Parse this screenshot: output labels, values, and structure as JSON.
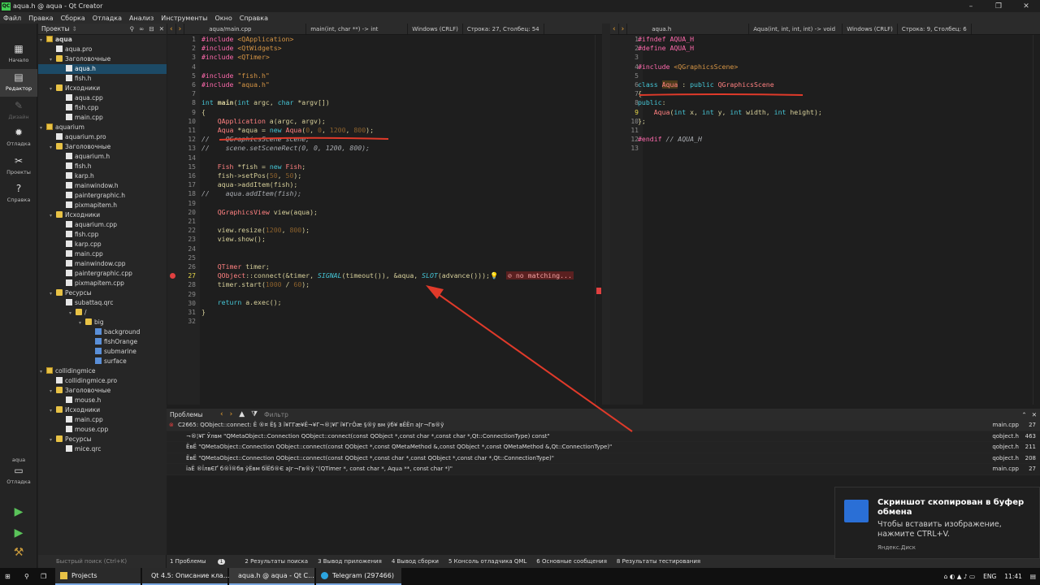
{
  "window": {
    "title": "aqua.h @ aqua - Qt Creator"
  },
  "menu": [
    "Файл",
    "Правка",
    "Сборка",
    "Отладка",
    "Анализ",
    "Инструменты",
    "Окно",
    "Справка"
  ],
  "modes": [
    {
      "label": "Начало",
      "icon": "▦"
    },
    {
      "label": "Редактор",
      "icon": "▤"
    },
    {
      "label": "Дизайн",
      "icon": "✎"
    },
    {
      "label": "Отладка",
      "icon": "✹"
    },
    {
      "label": "Проекты",
      "icon": "✂"
    },
    {
      "label": "Справка",
      "icon": "?"
    }
  ],
  "kit": {
    "name": "aqua",
    "label": "Отладка"
  },
  "projects": {
    "title": "Проекты",
    "rows": [
      {
        "t": "aqua",
        "lvl": 0,
        "icon": "proj",
        "bold": true
      },
      {
        "t": "aqua.pro",
        "lvl": 1,
        "icon": "file"
      },
      {
        "t": "Заголовочные",
        "lvl": 1,
        "icon": "folder"
      },
      {
        "t": "aqua.h",
        "lvl": 2,
        "icon": "file",
        "sel": true
      },
      {
        "t": "fish.h",
        "lvl": 2,
        "icon": "file"
      },
      {
        "t": "Исходники",
        "lvl": 1,
        "icon": "folder"
      },
      {
        "t": "aqua.cpp",
        "lvl": 2,
        "icon": "file"
      },
      {
        "t": "fish.cpp",
        "lvl": 2,
        "icon": "file"
      },
      {
        "t": "main.cpp",
        "lvl": 2,
        "icon": "file"
      },
      {
        "t": "aquarium",
        "lvl": 0,
        "icon": "proj"
      },
      {
        "t": "aquarium.pro",
        "lvl": 1,
        "icon": "file"
      },
      {
        "t": "Заголовочные",
        "lvl": 1,
        "icon": "folder"
      },
      {
        "t": "aquarium.h",
        "lvl": 2,
        "icon": "file"
      },
      {
        "t": "fish.h",
        "lvl": 2,
        "icon": "file"
      },
      {
        "t": "karp.h",
        "lvl": 2,
        "icon": "file"
      },
      {
        "t": "mainwindow.h",
        "lvl": 2,
        "icon": "file"
      },
      {
        "t": "paintergraphic.h",
        "lvl": 2,
        "icon": "file"
      },
      {
        "t": "pixmapitem.h",
        "lvl": 2,
        "icon": "file"
      },
      {
        "t": "Исходники",
        "lvl": 1,
        "icon": "folder"
      },
      {
        "t": "aquarium.cpp",
        "lvl": 2,
        "icon": "file"
      },
      {
        "t": "fish.cpp",
        "lvl": 2,
        "icon": "file"
      },
      {
        "t": "karp.cpp",
        "lvl": 2,
        "icon": "file"
      },
      {
        "t": "main.cpp",
        "lvl": 2,
        "icon": "file"
      },
      {
        "t": "mainwindow.cpp",
        "lvl": 2,
        "icon": "file"
      },
      {
        "t": "paintergraphic.cpp",
        "lvl": 2,
        "icon": "file"
      },
      {
        "t": "pixmapitem.cpp",
        "lvl": 2,
        "icon": "file"
      },
      {
        "t": "Ресурсы",
        "lvl": 1,
        "icon": "folder"
      },
      {
        "t": "subattaq.qrc",
        "lvl": 2,
        "icon": "file"
      },
      {
        "t": "/",
        "lvl": 3,
        "icon": "folder"
      },
      {
        "t": "big",
        "lvl": 4,
        "icon": "folder"
      },
      {
        "t": "background",
        "lvl": 5,
        "icon": "img"
      },
      {
        "t": "fishOrange",
        "lvl": 5,
        "icon": "img"
      },
      {
        "t": "submarine",
        "lvl": 5,
        "icon": "img"
      },
      {
        "t": "surface",
        "lvl": 5,
        "icon": "img"
      },
      {
        "t": "collidingmice",
        "lvl": 0,
        "icon": "proj"
      },
      {
        "t": "collidingmice.pro",
        "lvl": 1,
        "icon": "file"
      },
      {
        "t": "Заголовочные",
        "lvl": 1,
        "icon": "folder"
      },
      {
        "t": "mouse.h",
        "lvl": 2,
        "icon": "file"
      },
      {
        "t": "Исходники",
        "lvl": 1,
        "icon": "folder"
      },
      {
        "t": "main.cpp",
        "lvl": 2,
        "icon": "file"
      },
      {
        "t": "mouse.cpp",
        "lvl": 2,
        "icon": "file"
      },
      {
        "t": "Ресурсы",
        "lvl": 1,
        "icon": "folder"
      },
      {
        "t": "mice.qrc",
        "lvl": 2,
        "icon": "file"
      }
    ]
  },
  "left_editor": {
    "file": "aqua/main.cpp",
    "func": "main(int, char **) -> int",
    "enc": "Windows (CRLF)",
    "pos": "Строка: 27, Столбец: 54",
    "current_line": 27,
    "error_hint": "no matching..."
  },
  "right_editor": {
    "file": "aqua.h",
    "func": "Aqua(int, int, int, int) -> void",
    "enc": "Windows (CRLF)",
    "pos": "Строка: 9, Столбец: 6",
    "current_line": 9
  },
  "issues": {
    "title": "Проблемы",
    "filter_placeholder": "Фильтр",
    "rows": [
      {
        "msg": "C2665: QObject::connect: Ё ®¤ Ё§ 3 ï¥ΓΓæ¥Ё¬¥Γ¬®¦¥Γ ï¥ГгÖæ §®ӯ вм ўб¥ вЁЁп  aЈг¬Γв®ў",
        "file": "main.cpp",
        "line": "27"
      },
      {
        "msg": "¬®¦¥Γ Ўлвм \"QMetaObject::Connection QObject::connect(const QObject *,const char *,const char *,Qt::ConnectionType) const\"",
        "file": "qobject.h",
        "line": "463"
      },
      {
        "msg": "ЁвЁ     \"QMetaObject::Connection QObject::connect(const QObject *,const QMetaMethod &,const QObject *,const QMetaMethod &,Qt::ConnectionType)\"",
        "file": "qobject.h",
        "line": "211"
      },
      {
        "msg": "ЁвЁ     \"QMetaObject::Connection QObject::connect(const QObject *,const char *,const QObject *,const char *,Qt::ConnectionType)\"",
        "file": "qobject.h",
        "line": "208"
      },
      {
        "msg": "їаЁ ®ЇлвЄҐ б®Ї®бв ўЁвм бЇЁб®Є  aЈг¬Γв®ў \"(QTimer *, const char *, Aqua **, const char *)\"",
        "file": "main.cpp",
        "line": "27"
      }
    ]
  },
  "status": {
    "search_placeholder": "Быстрый поиск (Ctrl+K)",
    "tabs": [
      "1 Проблемы",
      "2 Результаты поиска",
      "3 Вывод приложения",
      "4 Вывод сборки",
      "5 Консоль отладчика QML",
      "6 Основные сообщения",
      "8 Результаты тестирования"
    ],
    "problems_count": "1"
  },
  "toast": {
    "title": "Скриншот скопирован в буфер обмена",
    "message": "Чтобы вставить изображение, нажмите CTRL+V.",
    "source": "Яндекс.Диск"
  },
  "taskbar": {
    "items": [
      "Projects",
      "Qt 4.5: Описание кла...",
      "aqua.h @ aqua - Qt C...",
      "Telegram (297466)"
    ],
    "lang": "ENG",
    "time": "11:41"
  },
  "colors": {
    "error": "#e04040",
    "annotation": "#e03a2a",
    "accent": "#1c4a66"
  }
}
